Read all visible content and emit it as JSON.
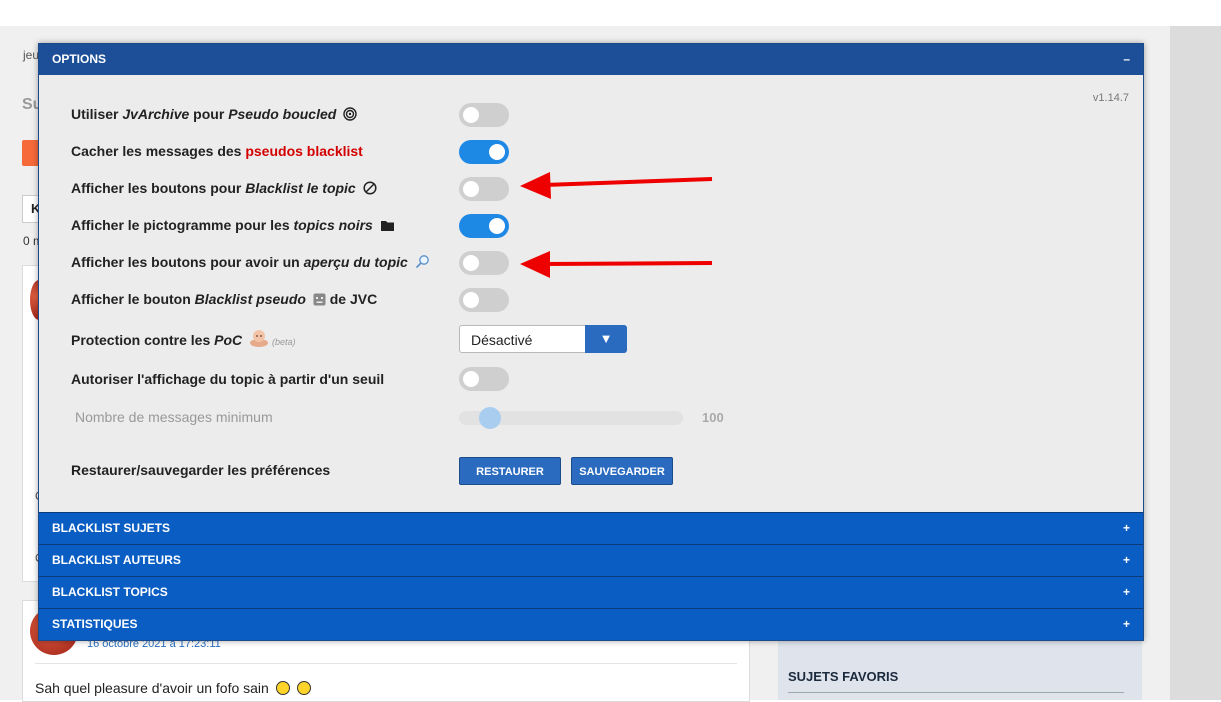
{
  "background": {
    "frag_jeu": "jeu",
    "frag_su": "Su",
    "frag_k": "K",
    "frag_0m": "0 m",
    "frag_o1": "O",
    "frag_o2": "O",
    "post_date": "16 octobre 2021 à 17:23:11",
    "post_message": "Sah quel pleasure d'avoir un fofo sain",
    "sidebar_title": "SUJETS FAVORIS"
  },
  "modal": {
    "header_title": "OPTIONS",
    "header_toggle": "–",
    "version": "v1.14.7",
    "options": [
      {
        "pre": "Utiliser ",
        "em": "JvArchive",
        "mid": " pour ",
        "em2": "Pseudo boucled",
        "icon": "spiral-icon",
        "enabled": false
      },
      {
        "pre": "Cacher les messages des ",
        "highlight": "pseudos blacklist",
        "enabled": true
      },
      {
        "pre": "Afficher les boutons pour ",
        "em": "Blacklist le topic",
        "icon": "forbidden-icon",
        "enabled": false
      },
      {
        "pre": "Afficher le pictogramme pour les ",
        "em": "topics noirs",
        "icon": "folder-icon",
        "enabled": true
      },
      {
        "pre": "Afficher les boutons pour avoir un ",
        "em": "aperçu du topic",
        "icon": "magnifier-icon",
        "enabled": false
      },
      {
        "pre": "Afficher le bouton ",
        "em": "Blacklist pseudo",
        "icon": "sad-face-icon",
        "post": " de JVC",
        "enabled": false
      },
      {
        "pre": "Protection contre les ",
        "em": "PoC",
        "icon": "baby-icon",
        "beta": "(beta)"
      },
      {
        "pre": "Autoriser l'affichage du topic à partir d'un seuil",
        "enabled": false
      }
    ],
    "poc_select_value": "Désactivé",
    "poc_select_arrow": "▼",
    "slider": {
      "label": "Nombre de messages minimum",
      "value": 100
    },
    "restore_label": "Restaurer/sauvegarder les préférences",
    "restore_button": "RESTAURER",
    "save_button": "SAUVEGARDER",
    "sections": [
      {
        "title": "BLACKLIST SUJETS",
        "toggle": "+"
      },
      {
        "title": "BLACKLIST AUTEURS",
        "toggle": "+"
      },
      {
        "title": "BLACKLIST TOPICS",
        "toggle": "+"
      },
      {
        "title": "STATISTIQUES",
        "toggle": "+"
      }
    ]
  },
  "colors": {
    "header": "#1c4f97",
    "section": "#0a5dc2",
    "toggle_on": "#1e88e5",
    "highlight": "#d40000",
    "annotation_arrow": "#ee0000"
  }
}
